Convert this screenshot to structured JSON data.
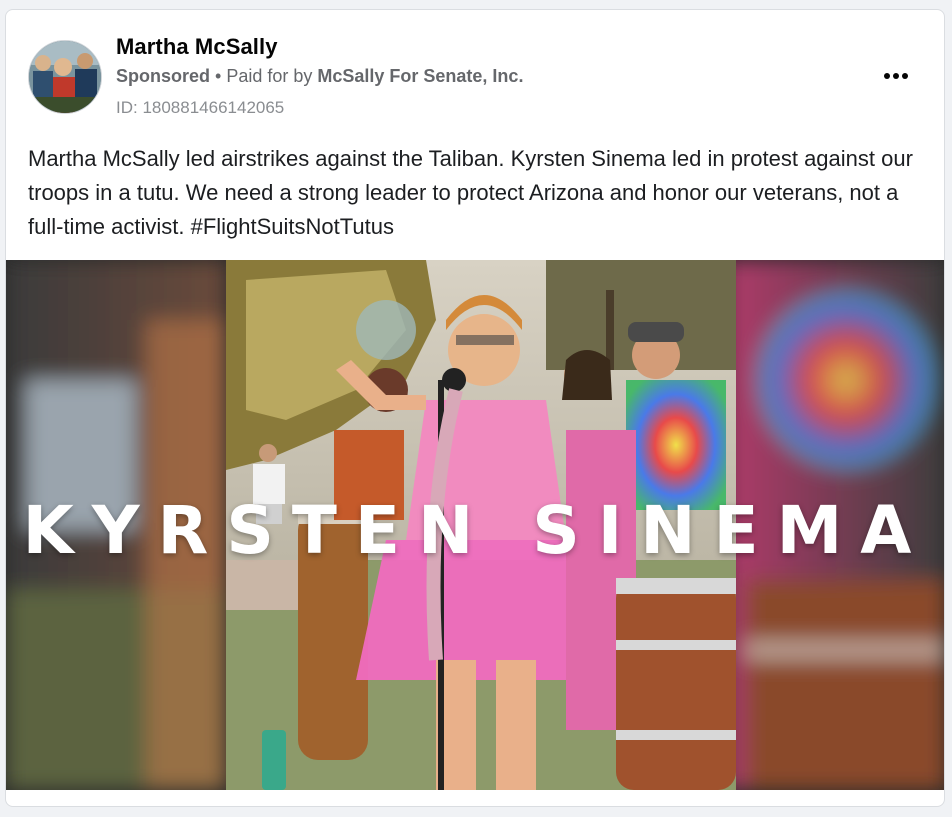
{
  "post": {
    "page_name": "Martha McSally",
    "sponsored_label": "Sponsored",
    "separator": " • Paid for by ",
    "paid_for_by": "McSally For Senate, Inc.",
    "ad_id": "ID: 180881466142065",
    "body": "Martha McSally led airstrikes against the Taliban. Kyrsten Sinema led in protest against our troops in a tutu. We need a strong leader to protect Arizona and honor our veterans, not a full-time activist. #FlightSuitsNotTutus",
    "more_icon": "more-horizontal-icon"
  },
  "media": {
    "overlay_text": "KYRSTEN SINEMA"
  },
  "colors": {
    "card_border": "#dadde1",
    "secondary_text": "#65676b",
    "primary_text": "#050505"
  }
}
